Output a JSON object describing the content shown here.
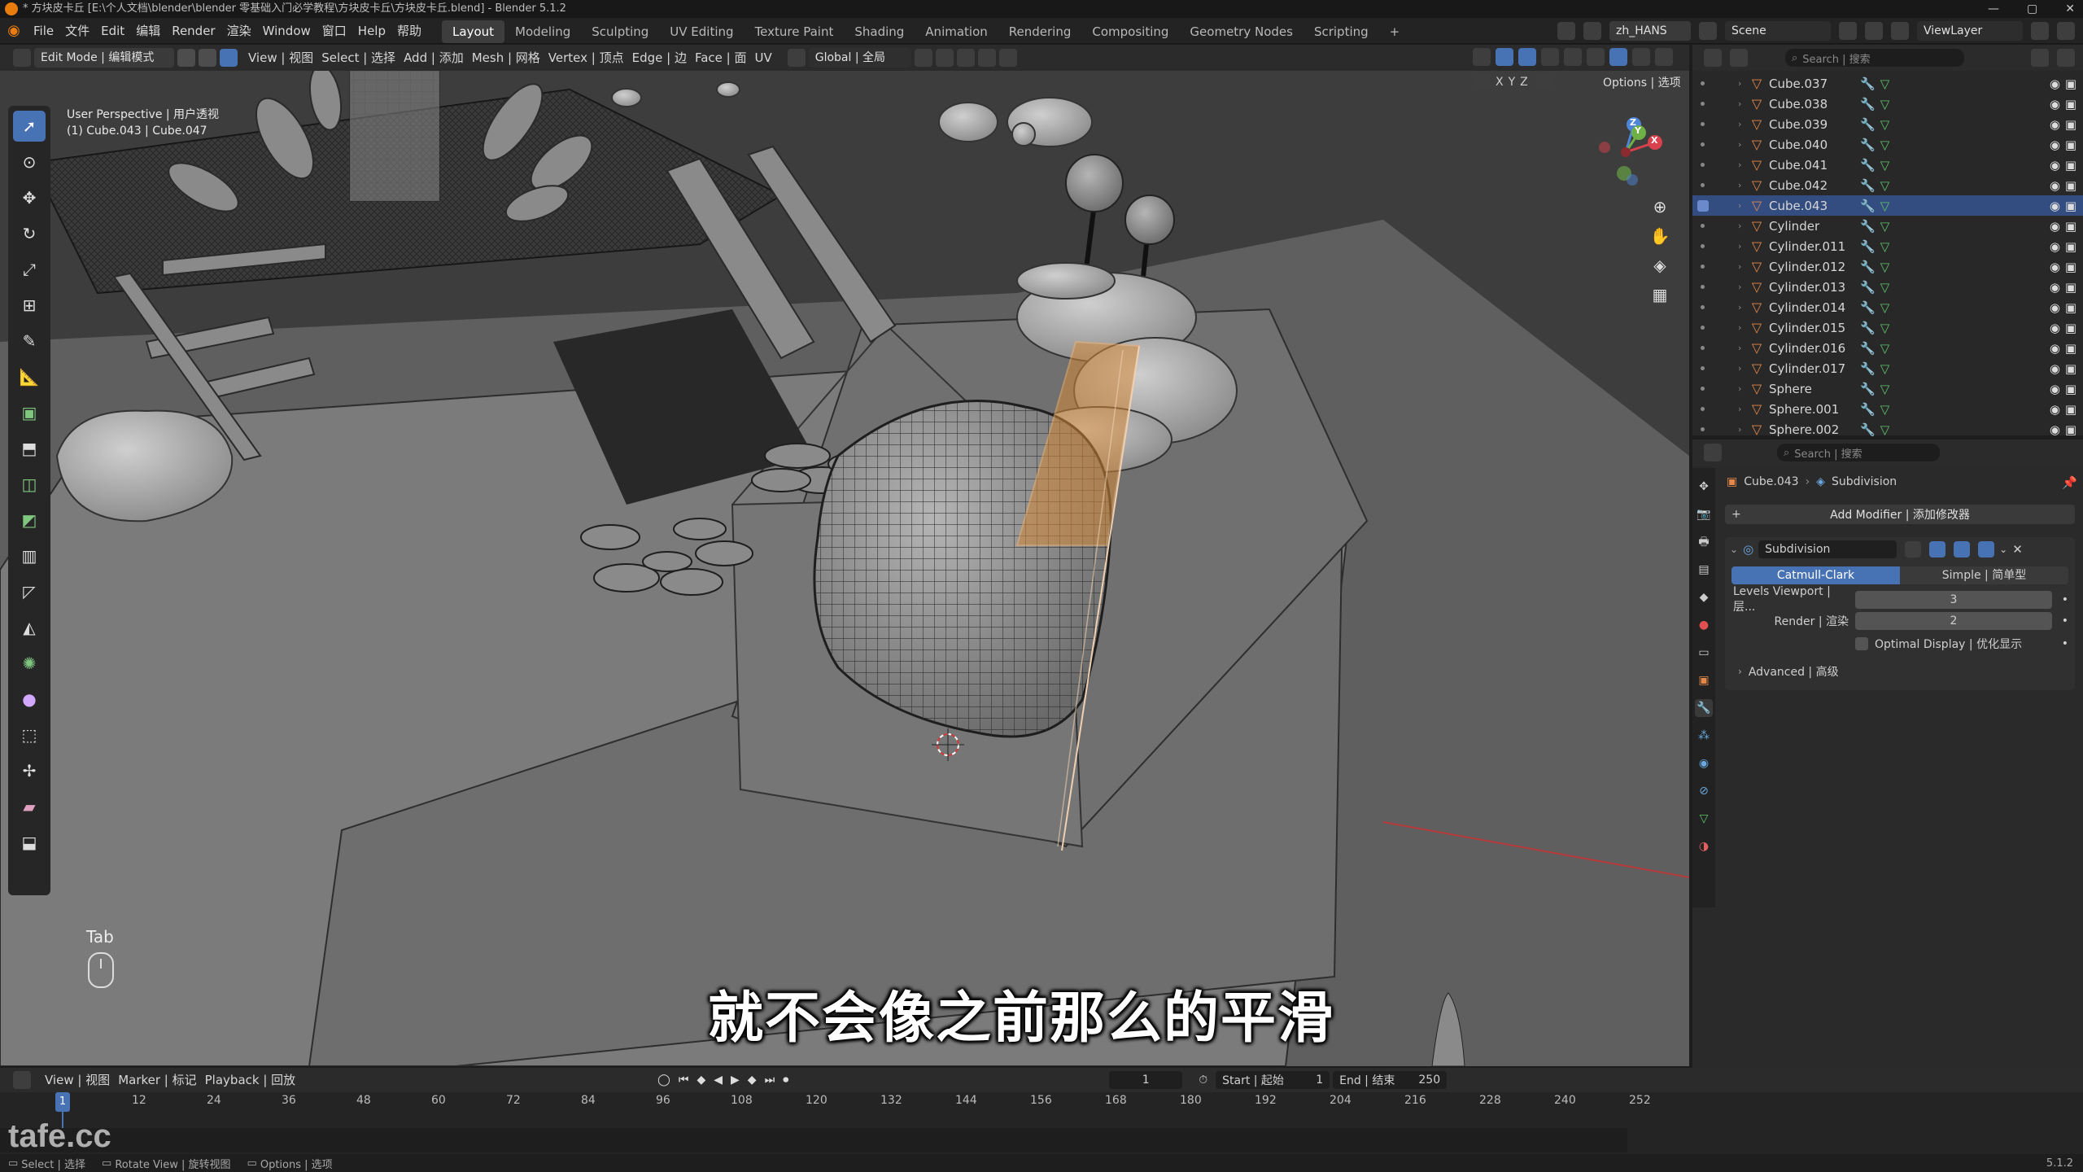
{
  "window": {
    "title": "* 方块皮卡丘 [E:\\个人文档\\blender\\blender 零基础入门必学教程\\方块皮卡丘\\方块皮卡丘.blend] - Blender 5.1.2",
    "min": "—",
    "max": "▢",
    "close": "✕"
  },
  "menu": [
    {
      "id": "file",
      "label": "File"
    },
    {
      "id": "file-cn",
      "label": "文件"
    },
    {
      "id": "edit",
      "label": "Edit"
    },
    {
      "id": "edit-cn",
      "label": "编辑"
    },
    {
      "id": "render",
      "label": "Render"
    },
    {
      "id": "render-cn",
      "label": "渲染"
    },
    {
      "id": "window",
      "label": "Window"
    },
    {
      "id": "window-cn",
      "label": "窗口"
    },
    {
      "id": "help",
      "label": "Help"
    },
    {
      "id": "help-cn",
      "label": "帮助"
    }
  ],
  "workspaces": [
    "Layout",
    "Modeling",
    "Sculpting",
    "UV Editing",
    "Texture Paint",
    "Shading",
    "Animation",
    "Rendering",
    "Compositing",
    "Geometry Nodes",
    "Scripting"
  ],
  "workspace_add": "+",
  "topright": {
    "lang": "zh_HANS",
    "scene": "Scene",
    "viewlayer": "ViewLayer"
  },
  "header": {
    "mode": "Edit Mode | 编辑模式",
    "menus": [
      "View | 视图",
      "Select | 选择",
      "Add | 添加",
      "Mesh | 网格",
      "Vertex | 顶点",
      "Edge | 边",
      "Face | 面",
      "UV"
    ],
    "transform": "Global | 全局",
    "options": "Options | 选项",
    "axes": [
      "X",
      "Y",
      "Z"
    ]
  },
  "viewport": {
    "perspective": "User Perspective | 用户透视",
    "object": "(1) Cube.043 | Cube.047",
    "key_hint": "Tab",
    "subtitle": "就不会像之前那么的平滑",
    "gizmo": {
      "z": "Z",
      "y": "Y",
      "x": "X"
    }
  },
  "outliner": {
    "search_placeholder": "Search | 搜索",
    "items": [
      {
        "name": "Cube.037",
        "selected": false
      },
      {
        "name": "Cube.038",
        "selected": false
      },
      {
        "name": "Cube.039",
        "selected": false
      },
      {
        "name": "Cube.040",
        "selected": false
      },
      {
        "name": "Cube.041",
        "selected": false
      },
      {
        "name": "Cube.042",
        "selected": false
      },
      {
        "name": "Cube.043",
        "selected": true
      },
      {
        "name": "Cylinder",
        "selected": false
      },
      {
        "name": "Cylinder.011",
        "selected": false
      },
      {
        "name": "Cylinder.012",
        "selected": false
      },
      {
        "name": "Cylinder.013",
        "selected": false
      },
      {
        "name": "Cylinder.014",
        "selected": false
      },
      {
        "name": "Cylinder.015",
        "selected": false
      },
      {
        "name": "Cylinder.016",
        "selected": false
      },
      {
        "name": "Cylinder.017",
        "selected": false
      },
      {
        "name": "Sphere",
        "selected": false
      },
      {
        "name": "Sphere.001",
        "selected": false
      },
      {
        "name": "Sphere.002",
        "selected": false
      }
    ]
  },
  "properties": {
    "search_placeholder": "Search | 搜索",
    "breadcrumb_object": "Cube.043",
    "breadcrumb_modifier": "Subdivision",
    "add_modifier": "Add Modifier | 添加修改器",
    "modifier_name": "Subdivision",
    "catmull": "Catmull-Clark",
    "simple": "Simple | 简单型",
    "levels_label": "Levels Viewport | 层...",
    "levels_value": "3",
    "render_label": "Render | 渲染",
    "render_value": "2",
    "optimal": "Optimal Display | 优化显示",
    "advanced": "Advanced | 高级"
  },
  "timeline": {
    "menus": [
      "View | 视图",
      "Marker | 标记",
      "Playback | 回放"
    ],
    "current_frame": "1",
    "start_label": "Start | 起始",
    "start": "1",
    "end_label": "End | 结束",
    "end": "250",
    "ticks": [
      "1",
      "12",
      "24",
      "36",
      "48",
      "60",
      "72",
      "84",
      "96",
      "108",
      "120",
      "132",
      "144",
      "156",
      "168",
      "180",
      "192",
      "204",
      "216",
      "228",
      "240",
      "252"
    ]
  },
  "status": {
    "select": "Select | 选择",
    "rotate": "Rotate View | 旋转视图",
    "options": "Options | 选项",
    "version": "5.1.2",
    "watermark": "tafe.cc"
  },
  "colors": {
    "accent": "#4772b3",
    "object_orange": "#e4884a",
    "mesh_green": "#5fc36a",
    "selected_row": "#334d80"
  }
}
